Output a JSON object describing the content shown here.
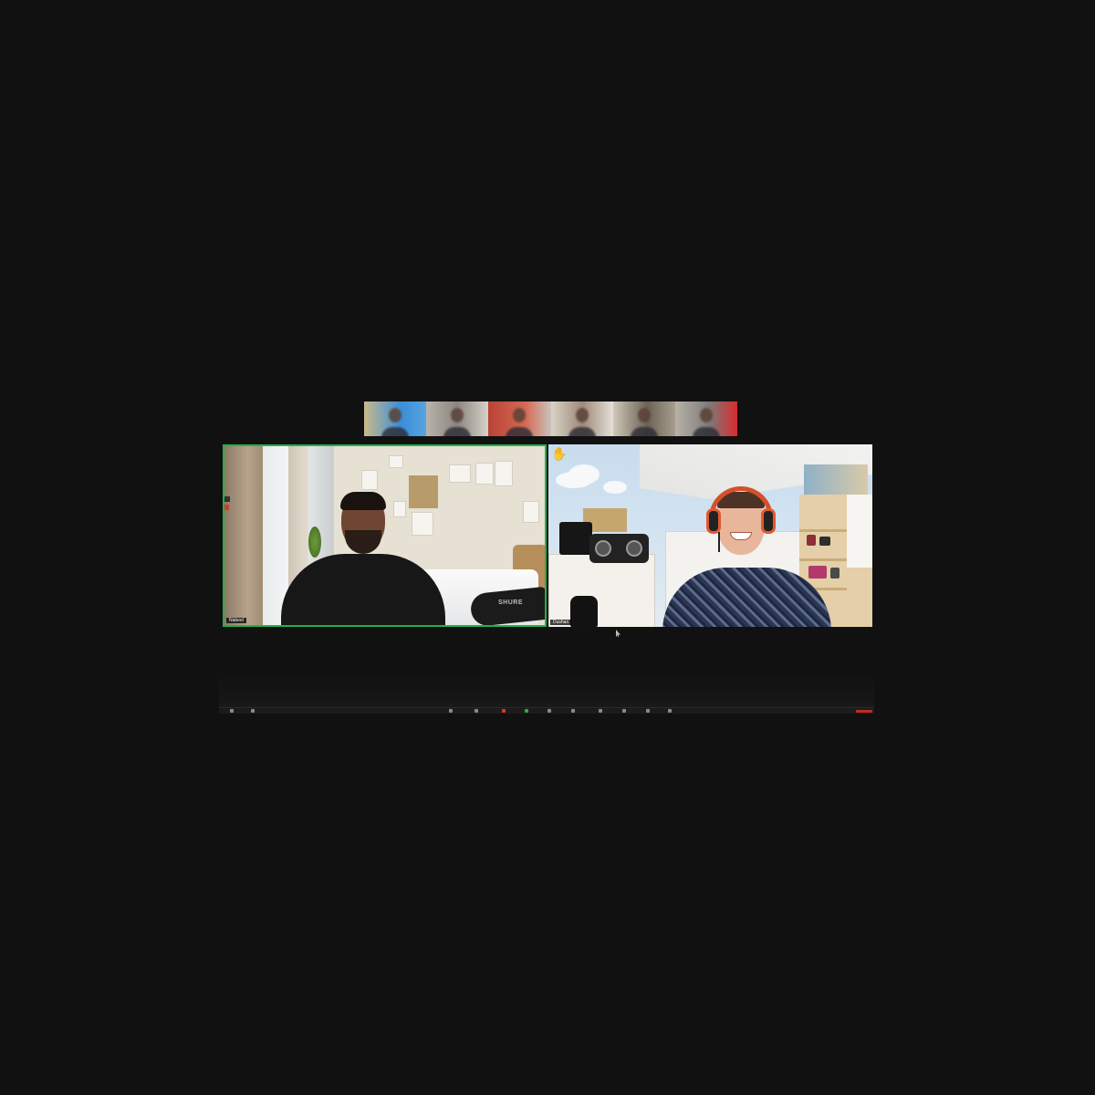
{
  "window": {
    "background": "#111111"
  },
  "thumbnail_strip": {
    "thumbnails": [
      {
        "id": 1
      },
      {
        "id": 2
      },
      {
        "id": 3
      },
      {
        "id": 4
      },
      {
        "id": 5
      },
      {
        "id": 6
      }
    ]
  },
  "tiles": [
    {
      "participant_name": "Nabeel",
      "active_speaker": true,
      "speaker_border_color": "#23b04b",
      "mic_brand": "SHURE"
    },
    {
      "participant_name": "Dushan",
      "active_speaker": false,
      "raised_hand": "✋"
    }
  ],
  "control_bar": {
    "end_button_color": "#c62b22",
    "accent_green": "#23b04b"
  }
}
